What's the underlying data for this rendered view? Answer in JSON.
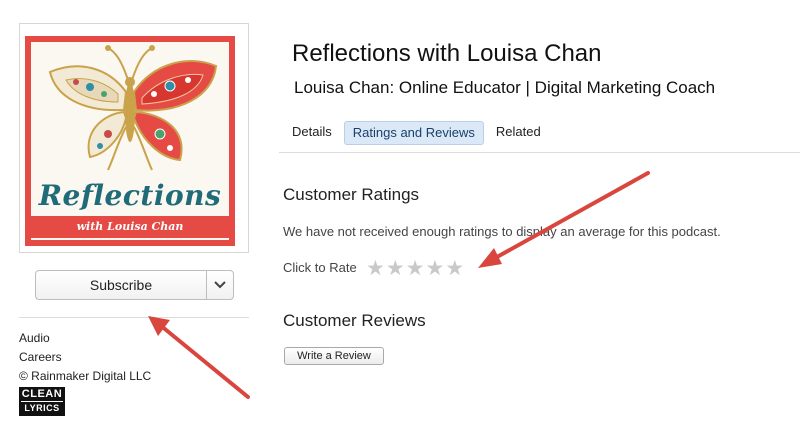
{
  "podcast": {
    "title": "Reflections with Louisa Chan",
    "author": "Louisa Chan: Online Educator | Digital Marketing Coach"
  },
  "artwork": {
    "title": "Reflections",
    "banner": "with Louisa Chan",
    "icon": "butterfly-icon",
    "colors": {
      "border": "#e64a45",
      "title": "#1f6b78",
      "background": "#fbf7f1"
    }
  },
  "subscribe": {
    "label": "Subscribe",
    "menu_icon": "chevron-down-icon"
  },
  "meta": {
    "category": "Audio",
    "subcategory": "Careers",
    "copyright": "© Rainmaker Digital LLC",
    "badge": {
      "line1": "CLEAN",
      "line2": "LYRICS"
    }
  },
  "tabs": [
    {
      "label": "Details",
      "active": false
    },
    {
      "label": "Ratings and Reviews",
      "active": true
    },
    {
      "label": "Related",
      "active": false
    }
  ],
  "ratings": {
    "heading": "Customer Ratings",
    "message": "We have not received enough ratings to display an average for this podcast.",
    "click_to_rate": "Click to Rate",
    "stars_filled": 0,
    "stars_total": 5
  },
  "reviews": {
    "heading": "Customer Reviews",
    "write_button": "Write a Review"
  },
  "annotations": {
    "arrow_color": "#d9463e",
    "arrow_icon": "arrow-icon"
  }
}
